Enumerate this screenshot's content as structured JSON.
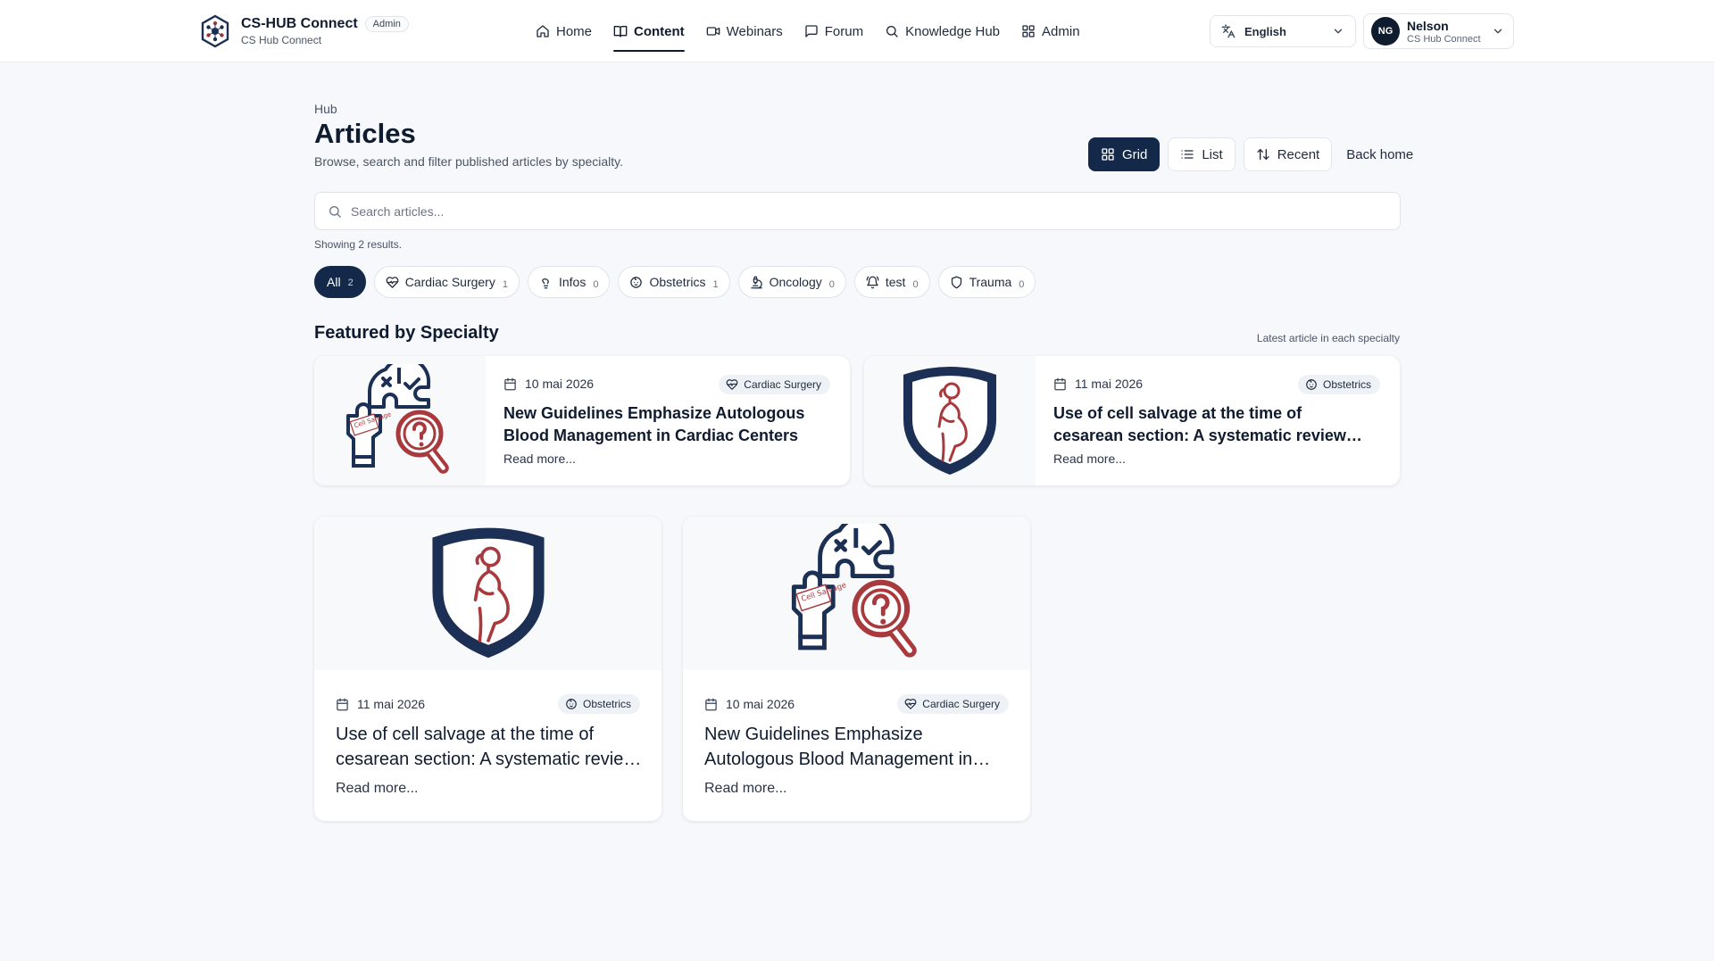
{
  "app": {
    "name": "CS-HUB Connect",
    "badge": "Admin",
    "subtitle": "CS Hub Connect"
  },
  "nav": {
    "items": [
      {
        "label": "Home",
        "icon": "home-icon"
      },
      {
        "label": "Content",
        "icon": "book-icon",
        "active": true
      },
      {
        "label": "Webinars",
        "icon": "video-icon"
      },
      {
        "label": "Forum",
        "icon": "message-icon"
      },
      {
        "label": "Knowledge Hub",
        "icon": "search-icon"
      },
      {
        "label": "Admin",
        "icon": "grid-icon"
      }
    ]
  },
  "language": {
    "label": "English",
    "icon": "translate-icon"
  },
  "user": {
    "initials": "NG",
    "name": "Nelson",
    "org": "CS Hub Connect"
  },
  "header": {
    "breadcrumb": "Hub",
    "title": "Articles",
    "subtitle": "Browse, search and filter published articles by specialty."
  },
  "view_controls": {
    "grid": "Grid",
    "list": "List",
    "sort": "Recent",
    "back": "Back home",
    "active": "grid"
  },
  "search": {
    "placeholder": "Search articles...",
    "value": ""
  },
  "results_text": "Showing 2 results.",
  "filters": [
    {
      "label": "All",
      "count": "2",
      "icon": "",
      "active": true
    },
    {
      "label": "Cardiac Surgery",
      "count": "1",
      "icon": "heart-pulse-icon"
    },
    {
      "label": "Infos",
      "count": "0",
      "icon": "lightbulb-icon"
    },
    {
      "label": "Obstetrics",
      "count": "1",
      "icon": "baby-icon"
    },
    {
      "label": "Oncology",
      "count": "0",
      "icon": "microscope-icon"
    },
    {
      "label": "test",
      "count": "0",
      "icon": "bell-icon"
    },
    {
      "label": "Trauma",
      "count": "0",
      "icon": "shield-icon"
    }
  ],
  "featured": {
    "title": "Featured by Specialty",
    "note": "Latest article in each specialty",
    "cards": [
      {
        "date": "10 mai 2026",
        "tag": "Cardiac Surgery",
        "tag_icon": "heart-pulse-icon",
        "title": "New Guidelines Emphasize Autologous Blood Management in Cardiac Centers",
        "more": "Read more...",
        "image": "puzzle-magnifier-illustration"
      },
      {
        "date": "11 mai 2026",
        "tag": "Obstetrics",
        "tag_icon": "baby-icon",
        "title": "Use of cell salvage at the time of cesarean section: A systematic review and meta-analysis",
        "more": "Read more...",
        "image": "pregnant-shield-illustration"
      }
    ]
  },
  "articles": [
    {
      "date": "11 mai 2026",
      "tag": "Obstetrics",
      "tag_icon": "baby-icon",
      "title": "Use of cell salvage at the time of cesarean section: A systematic review and meta-analysis",
      "more": "Read more...",
      "image": "pregnant-shield-illustration"
    },
    {
      "date": "10 mai 2026",
      "tag": "Cardiac Surgery",
      "tag_icon": "heart-pulse-icon",
      "title": "New Guidelines Emphasize Autologous Blood Management in Cardiac Centers",
      "more": "Read more...",
      "image": "puzzle-magnifier-illustration"
    }
  ],
  "illustration_text": "Cell Salvage",
  "colors": {
    "navy": "#14294a",
    "brand_dark": "#1c2f55",
    "accent_red": "#a83a3e",
    "background": "#f6f8fb"
  }
}
